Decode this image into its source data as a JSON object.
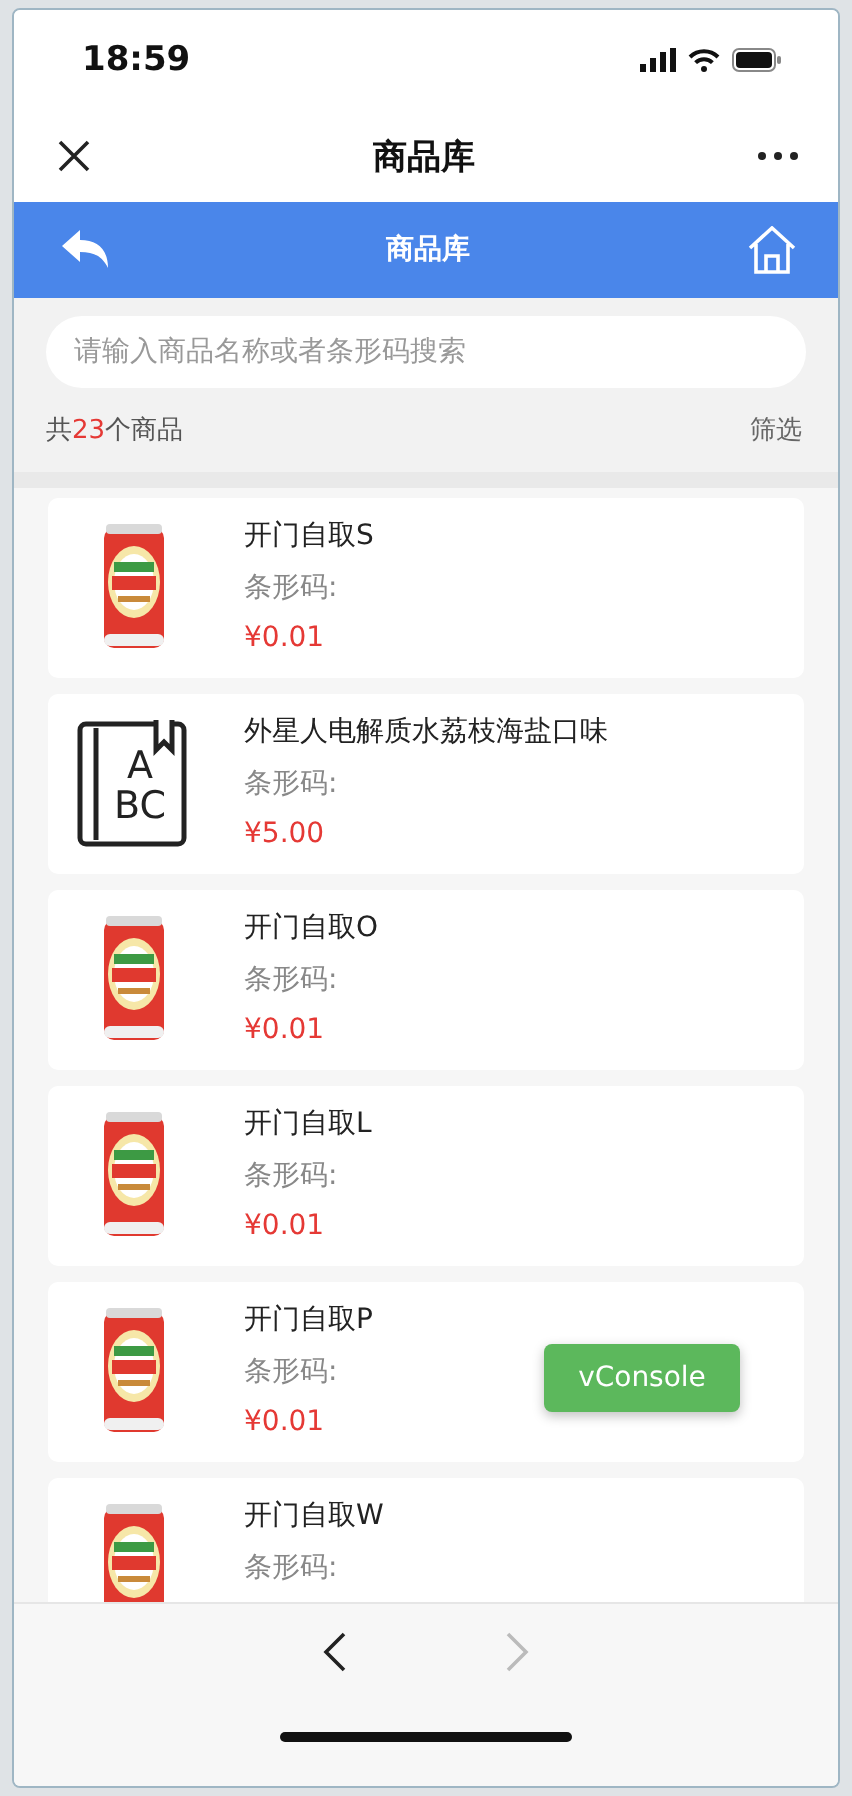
{
  "status_bar": {
    "time": "18:59"
  },
  "mini_nav": {
    "title": "商品库"
  },
  "header": {
    "title": "商品库"
  },
  "search": {
    "placeholder": "请输入商品名称或者条形码搜索"
  },
  "summary": {
    "prefix": "共",
    "count": "23",
    "suffix": "个商品",
    "filter": "筛选"
  },
  "products": [
    {
      "name": "开门自取S",
      "barcode_label": "条形码:",
      "price": "¥0.01"
    },
    {
      "kind": "placeholder",
      "image_letters": [
        "A",
        "BC"
      ],
      "name": "外星人电解质水荔枝海盐口味",
      "barcode_label": "条形码:",
      "price": "¥5.00"
    },
    {
      "name": "开门自取O",
      "barcode_label": "条形码:",
      "price": "¥0.01"
    },
    {
      "name": "开门自取L",
      "barcode_label": "条形码:",
      "price": "¥0.01"
    },
    {
      "name": "开门自取P",
      "barcode_label": "条形码:",
      "price": "¥0.01"
    },
    {
      "name": "开门自取W",
      "barcode_label": "条形码:"
    }
  ],
  "floating_button": {
    "label": "vConsole"
  },
  "browser_nav": {
    "back_disabled": false,
    "forward_disabled": true
  }
}
